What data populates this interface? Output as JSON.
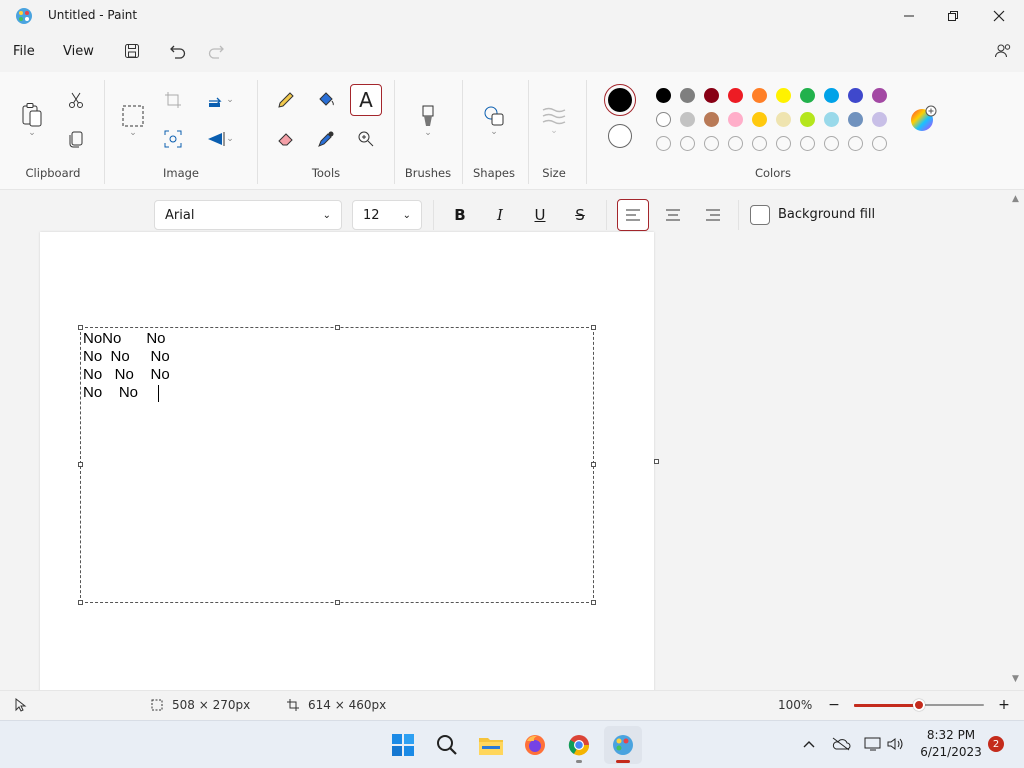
{
  "window": {
    "title": "Untitled - Paint"
  },
  "menu": {
    "file": "File",
    "view": "View"
  },
  "ribbon": {
    "groups": {
      "clipboard": "Clipboard",
      "image": "Image",
      "tools": "Tools",
      "brushes": "Brushes",
      "shapes": "Shapes",
      "size": "Size",
      "colors": "Colors"
    }
  },
  "colors": {
    "primary": "#000000",
    "secondary": "#ffffff",
    "row1": [
      "#000000",
      "#7f7f7f",
      "#880015",
      "#ed1c24",
      "#ff7f27",
      "#fff200",
      "#22b14c",
      "#00a2e8",
      "#3f48cc",
      "#a349a4"
    ],
    "row2": [
      "#ffffff",
      "#c3c3c3",
      "#b97a57",
      "#ffaec9",
      "#ffc90e",
      "#efe4b0",
      "#b5e61d",
      "#99d9ea",
      "#7092be",
      "#c8bfe7"
    ],
    "row3_empty_count": "10"
  },
  "text_toolbar": {
    "font": "Arial",
    "size": "12",
    "background_fill": "Background fill"
  },
  "canvas": {
    "text": "NoNo      No\nNo  No     No\nNo   No    No\nNo    No   "
  },
  "status": {
    "selection": "508 × 270px",
    "canvas_size": "614 × 460px",
    "zoom": "100%",
    "zoom_fraction": 0.5
  },
  "taskbar": {
    "time": "8:32 PM",
    "date": "6/21/2023",
    "notifications": "2"
  }
}
